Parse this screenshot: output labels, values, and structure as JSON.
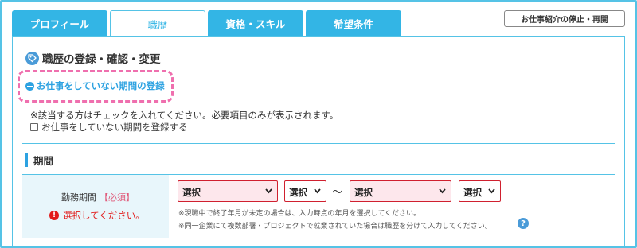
{
  "tabs": [
    {
      "label": "プロフィール"
    },
    {
      "label": "職歴"
    },
    {
      "label": "資格・スキル"
    },
    {
      "label": "希望条件"
    }
  ],
  "stop_button_label": "お仕事紹介の停止・再開",
  "section_title": "職歴の登録・確認・変更",
  "collapse_link": "お仕事をしていない期間の登録",
  "note_check": "※該当する方はチェックを入れてください。必要項目のみが表示されます。",
  "checkbox_label": "お仕事をしていない期間を登録する",
  "period_heading": "期間",
  "field": {
    "label": "勤務期間",
    "required": "【必須】",
    "error": "選択してください。"
  },
  "selects": {
    "start_year": "選択",
    "start_month": "選択",
    "separator": "～",
    "end_year": "選択",
    "end_month": "選択"
  },
  "notes": {
    "current_job": "※現職中で終了年月が未定の場合は、入力時点の年月を選択してください。",
    "multiple_departments": "※同一企業にて複数部署・プロジェクトで就業されていた場合は職歴を分けて入力してください。"
  },
  "help_icon": "?",
  "colors": {
    "accent": "#33b5e5",
    "error": "#e21b1b",
    "highlight_dash": "#ef6fae"
  }
}
